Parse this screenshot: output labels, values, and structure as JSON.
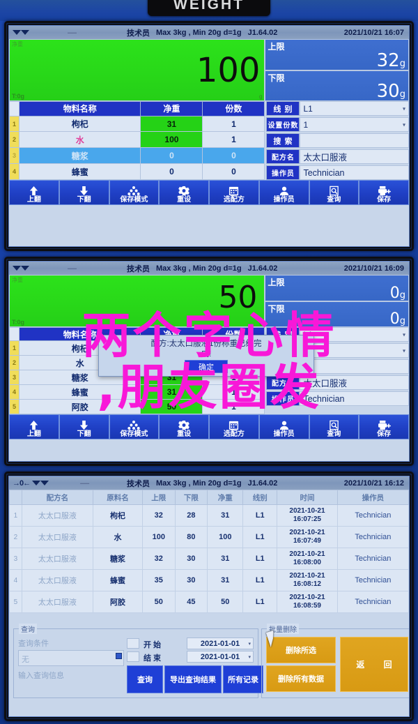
{
  "device": {
    "badge_label": "WEIGHT"
  },
  "watermark": {
    "line1": "两个字心情",
    "line2": ",朋友圈发"
  },
  "status": {
    "operator": "技术员",
    "capacity": "Max 3kg , Min 20g  d=1g",
    "version": "J1.64.02",
    "zero_symbol": "→0←"
  },
  "panel1": {
    "datetime": "2021/10/21  16:07",
    "display": {
      "tag_net": "净重",
      "tag_tare": "T:0g",
      "value": "100",
      "unit": "g"
    },
    "limits": [
      {
        "label": "上限",
        "value": "32",
        "unit": "g"
      },
      {
        "label": "下限",
        "value": "30",
        "unit": "g"
      }
    ],
    "table": {
      "headers": [
        "物料名称",
        "净重",
        "份数"
      ],
      "rows": [
        {
          "idx": "1",
          "name": "枸杞",
          "net": "31",
          "portions": "1"
        },
        {
          "idx": "2",
          "name": "水",
          "net": "100",
          "portions": "1"
        },
        {
          "idx": "3",
          "name": "糖浆",
          "net": "0",
          "portions": "0"
        },
        {
          "idx": "4",
          "name": "蜂蜜",
          "net": "0",
          "portions": "0"
        }
      ]
    },
    "fields": [
      {
        "label": "线 别",
        "value": "L1",
        "dropdown": true
      },
      {
        "label": "设置份数",
        "value": "1",
        "dropdown": true
      },
      {
        "label": "搜 索",
        "value": "",
        "dropdown": false
      },
      {
        "label": "配方名",
        "value": "太太口服液",
        "dropdown": false
      },
      {
        "label": "操作员",
        "value": "Technician",
        "dropdown": false
      }
    ]
  },
  "panel2": {
    "datetime": "2021/10/21  16:09",
    "display": {
      "tag_net": "净重",
      "tag_tare": "T:0g",
      "value": "50",
      "unit": "g"
    },
    "limits": [
      {
        "label": "上限",
        "value": "0",
        "unit": "g"
      },
      {
        "label": "下限",
        "value": "0",
        "unit": "g"
      }
    ],
    "table": {
      "headers": [
        "物料名称",
        "净重",
        "份数"
      ],
      "rows": [
        {
          "idx": "1",
          "name": "枸杞",
          "net": "31",
          "portions": "1"
        },
        {
          "idx": "2",
          "name": "水",
          "net": "100",
          "portions": "1"
        },
        {
          "idx": "3",
          "name": "糖浆",
          "net": "31",
          "portions": "1"
        },
        {
          "idx": "4",
          "name": "蜂蜜",
          "net": "31",
          "portions": "1"
        },
        {
          "idx": "5",
          "name": "阿胶",
          "net": "50",
          "portions": "1"
        }
      ]
    },
    "fields": [
      {
        "label": "线 别",
        "value": "L1",
        "dropdown": true
      },
      {
        "label": "设置份数",
        "value": "1",
        "dropdown": true
      },
      {
        "label": "搜 索",
        "value": "",
        "dropdown": false
      },
      {
        "label": "配方名",
        "value": "太太口服液",
        "dropdown": false
      },
      {
        "label": "操作员",
        "value": "Technician",
        "dropdown": false
      }
    ],
    "dialog": {
      "line1": "配方:太太口服液1份称重已经完",
      "line2": "成!",
      "ok_label": "确定"
    }
  },
  "toolbar": {
    "buttons": [
      {
        "label": "上翻",
        "icon": "arrow-up-icon"
      },
      {
        "label": "下翻",
        "icon": "arrow-down-icon"
      },
      {
        "label": "保存模式",
        "icon": "stack-icon"
      },
      {
        "label": "重设",
        "icon": "gear-icon"
      },
      {
        "label": "选配方",
        "icon": "calendar-icon"
      },
      {
        "label": "操作员",
        "icon": "user-icon"
      },
      {
        "label": "查询",
        "icon": "search-doc-icon"
      },
      {
        "label": "保存",
        "icon": "save-printer-icon"
      }
    ]
  },
  "panel3": {
    "datetime": "2021/10/21  16:12",
    "table": {
      "headers": [
        "配方名",
        "原料名",
        "上限",
        "下限",
        "净重",
        "线别",
        "时间",
        "操作员"
      ],
      "rows": [
        {
          "idx": "1",
          "recipe": "太太口服液",
          "material": "枸杞",
          "upper": "32",
          "lower": "28",
          "net": "31",
          "line": "L1",
          "date": "2021-10-21",
          "time": "16:07:25",
          "operator": "Technician"
        },
        {
          "idx": "2",
          "recipe": "太太口服液",
          "material": "水",
          "upper": "100",
          "lower": "80",
          "net": "100",
          "line": "L1",
          "date": "2021-10-21",
          "time": "16:07:49",
          "operator": "Technician"
        },
        {
          "idx": "3",
          "recipe": "太太口服液",
          "material": "糖浆",
          "upper": "32",
          "lower": "30",
          "net": "31",
          "line": "L1",
          "date": "2021-10-21",
          "time": "16:08:00",
          "operator": "Technician"
        },
        {
          "idx": "4",
          "recipe": "太太口服液",
          "material": "蜂蜜",
          "upper": "35",
          "lower": "30",
          "net": "31",
          "line": "L1",
          "date": "2021-10-21",
          "time": "16:08:12",
          "operator": "Technician"
        },
        {
          "idx": "5",
          "recipe": "太太口服液",
          "material": "阿胶",
          "upper": "50",
          "lower": "45",
          "net": "50",
          "line": "L1",
          "date": "2021-10-21",
          "time": "16:08:59",
          "operator": "Technician"
        }
      ]
    },
    "query_group": {
      "title": "查询",
      "condition_label": "查询条件",
      "condition_value": "无",
      "info_placeholder": "输入查询信息",
      "start_label": "开  始",
      "start_date": "2021-01-01",
      "end_label": "结  束",
      "end_date": "2021-01-01",
      "buttons": [
        "查询",
        "导出查询结果",
        "所有记录"
      ]
    },
    "delete_group": {
      "title": "批量删除",
      "delete_selected": "删除所选",
      "delete_all": "删除所有数据",
      "return_label": "返 回"
    }
  }
}
